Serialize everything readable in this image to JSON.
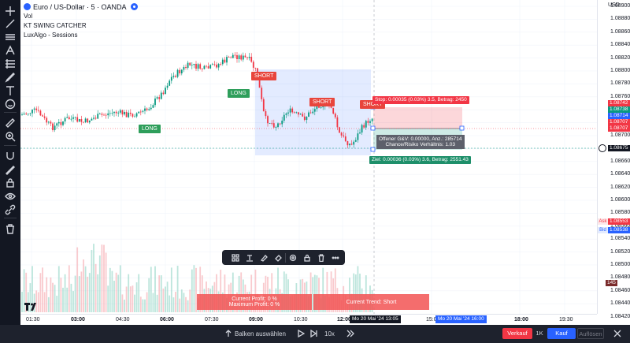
{
  "legend": {
    "symbol_title": "Euro / US-Dollar · 5 · OANDA",
    "indicators": [
      "Vol",
      "KT SWING CATCHER",
      "LuxAlgo - Sessions"
    ]
  },
  "signals": {
    "long_1": "LONG",
    "long_2": "LONG",
    "short_1": "SHORT",
    "short_2": "SHORT",
    "short_3": "SHORT"
  },
  "position_tool": {
    "stop_text": "Stop: 0.00035 (0.03%) 3.5, Betrag: 2450",
    "target_text": "Ziel: 0.00036 (0.03%) 3.6, Betrag: 2551.43",
    "info_line1": "Offener G&V: 0.00000, Anz.: 285714",
    "info_line2": "Chance/Risiko Verhältnis: 1.03"
  },
  "indicator_panel": {
    "profit_line1": "Current Profit:    0 %",
    "profit_line2": "Maximum Profit: 0 %",
    "trend": "Current Trend:  Short"
  },
  "price_scale": {
    "currency": "USD",
    "ticks": [
      "1.08900",
      "1.08880",
      "1.08860",
      "1.08840",
      "1.08820",
      "1.08800",
      "1.08780",
      "1.08760",
      "1.08740",
      "1.08720",
      "1.08700",
      "1.08680",
      "1.08660",
      "1.08640",
      "1.08620",
      "1.08600",
      "1.08580",
      "1.08560",
      "1.08540",
      "1.08520",
      "1.08500",
      "1.08480",
      "1.08460",
      "1.08440",
      "1.08420"
    ],
    "badge_stop": "1.08742",
    "badge_target": "1.08738",
    "badge_blue": "1.08714",
    "badge_red1": "1.08707",
    "badge_red2": "1.08707",
    "badge_current": "1.08675",
    "ask_label": "Ask",
    "ask_value": "1.08553",
    "bid_label": "Bid",
    "bid_value": "1.08538",
    "volume_badge": "145"
  },
  "time_axis": {
    "ticks": [
      "01:30",
      "03:00",
      "04:30",
      "06:00",
      "07:30",
      "09:00",
      "10:30",
      "12:00",
      "15:00",
      "18:00",
      "19:30"
    ],
    "cursor_start": "Mo 20 Mai '24   13:05",
    "cursor_end": "Mo 20 Mai '24   16:00"
  },
  "bottom_bar": {
    "select_bars": "Balken auswählen",
    "speed": "10x",
    "sell": "Verkauf",
    "quantity": "1K",
    "buy": "Kauf",
    "close": "Auflösen"
  },
  "colors": {
    "up": "#089981",
    "down": "#f23645",
    "accent": "#2962ff"
  }
}
